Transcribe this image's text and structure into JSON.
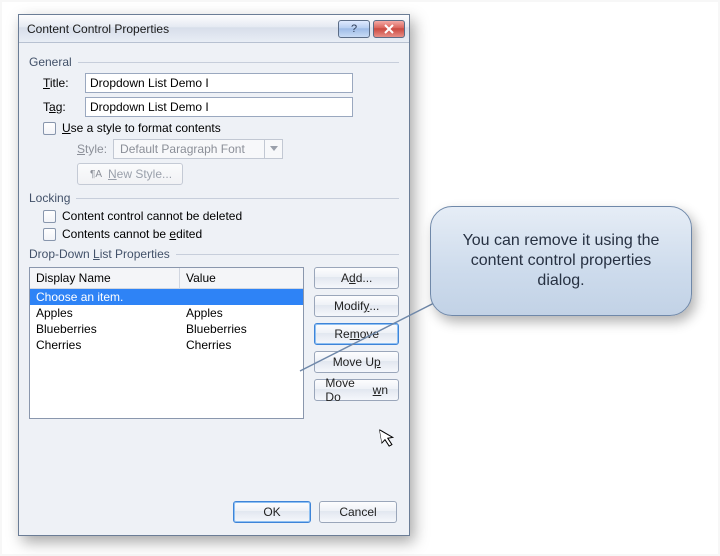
{
  "dialog": {
    "title": "Content Control Properties",
    "general": {
      "group_label": "General",
      "title_label": "Title:",
      "title_value": "Dropdown List Demo I",
      "tag_label": "Tag:",
      "tag_value": "Dropdown List Demo I",
      "use_style_label_pre": "U",
      "use_style_label_rest": "se a style to format contents",
      "style_label": "Style:",
      "style_value": "Default Paragraph Font",
      "new_style_label_pre": "N",
      "new_style_label_rest": "ew Style..."
    },
    "locking": {
      "group_label": "Locking",
      "cannot_delete": "Content control cannot be deleted",
      "cannot_edit_pre": "Contents cannot be ",
      "cannot_edit_u": "e",
      "cannot_edit_rest": "dited"
    },
    "ddlp": {
      "group_label_pre": "Drop-Down ",
      "group_label_u": "L",
      "group_label_rest": "ist Properties",
      "col_display": "Display Name",
      "col_value": "Value",
      "rows": [
        {
          "display": "Choose an item.",
          "value": "",
          "selected": true
        },
        {
          "display": "Apples",
          "value": "Apples",
          "selected": false
        },
        {
          "display": "Blueberries",
          "value": "Blueberries",
          "selected": false
        },
        {
          "display": "Cherries",
          "value": "Cherries",
          "selected": false
        }
      ],
      "buttons": {
        "add_pre": "A",
        "add_u": "d",
        "add_rest": "d...",
        "modify_pre": "Modif",
        "modify_u": "y",
        "modify_rest": "...",
        "remove_pre": "Re",
        "remove_u": "m",
        "remove_rest": "ove",
        "moveup_pre": "Move U",
        "moveup_u": "p",
        "moveup_rest": "",
        "movedown_pre": "Move Do",
        "movedown_u": "w",
        "movedown_rest": "n"
      }
    },
    "footer": {
      "ok": "OK",
      "cancel": "Cancel"
    }
  },
  "callout": {
    "text": "You can remove it using the content control properties dialog."
  }
}
